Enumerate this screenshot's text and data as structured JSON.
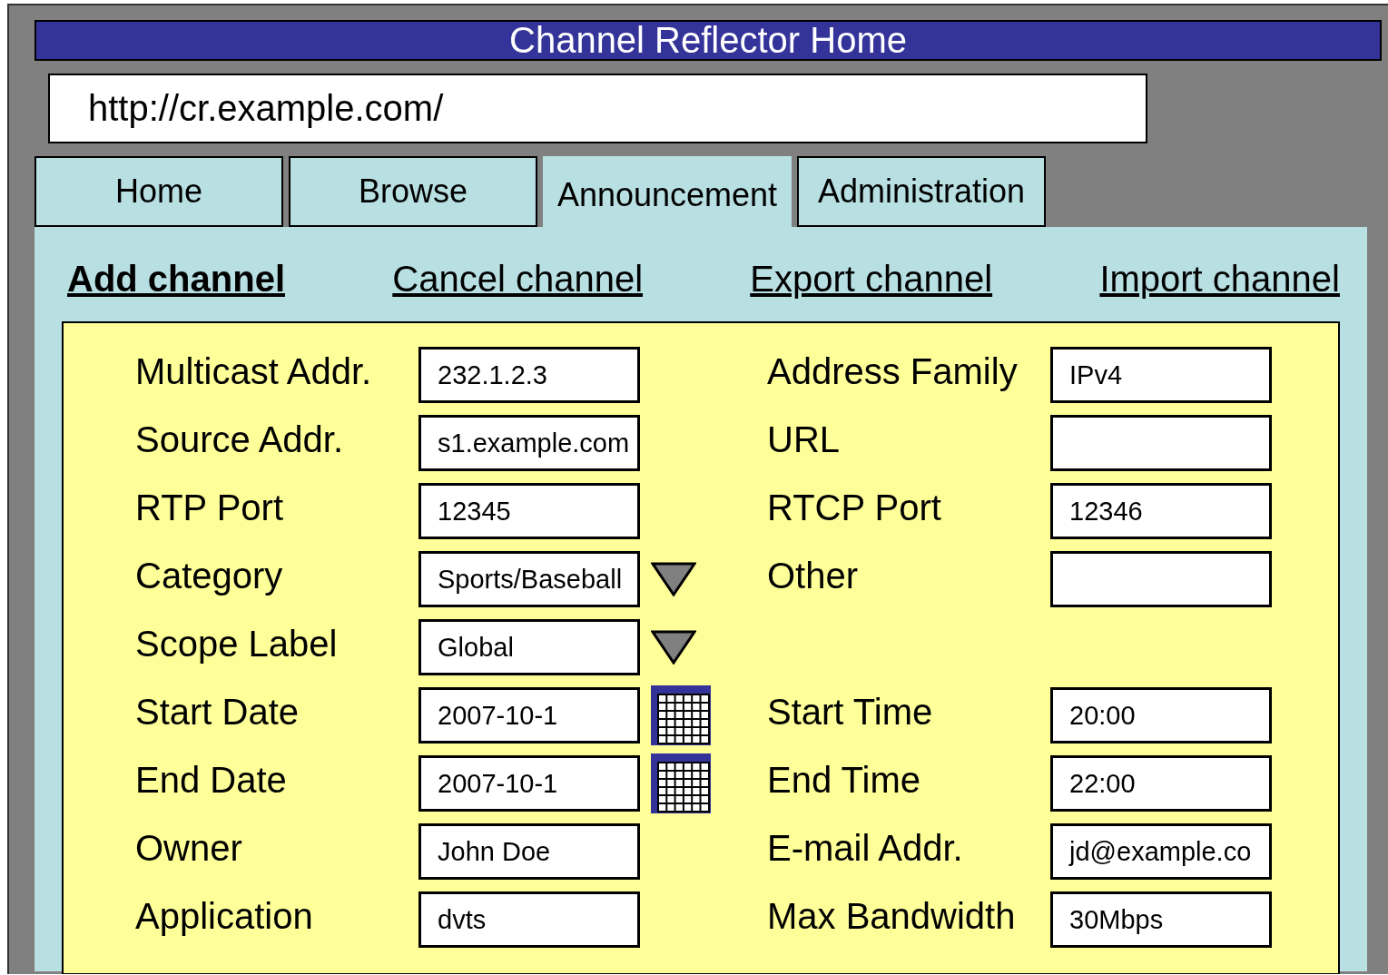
{
  "window": {
    "title": "Channel Reflector Home"
  },
  "address_bar": {
    "value": "http://cr.example.com/"
  },
  "tabs": [
    {
      "label": "Home",
      "selected": false
    },
    {
      "label": "Browse",
      "selected": false
    },
    {
      "label": "Announcement",
      "selected": true
    },
    {
      "label": "Administration",
      "selected": false
    }
  ],
  "actions": [
    {
      "label": "Add channel",
      "selected": true
    },
    {
      "label": "Cancel channel",
      "selected": false
    },
    {
      "label": "Export channel",
      "selected": false
    },
    {
      "label": "Import channel",
      "selected": false
    }
  ],
  "form": {
    "rows": [
      {
        "left": {
          "label": "Multicast Addr.",
          "value": "232.1.2.3",
          "kind": "text"
        },
        "right": {
          "label": "Address Family",
          "value": "IPv4"
        }
      },
      {
        "left": {
          "label": "Source Addr.",
          "value": "s1.example.com",
          "kind": "text"
        },
        "right": {
          "label": "URL"
        }
      },
      {
        "left": {
          "label": "RTP Port",
          "value": "12345",
          "kind": "text"
        },
        "right": {
          "label": "RTCP Port",
          "value": "12346"
        }
      },
      {
        "left": {
          "label": "Category",
          "value": "Sports/Baseball",
          "kind": "dropdown"
        },
        "right": {
          "label": "Other"
        }
      },
      {
        "left": {
          "label": "Scope Label",
          "value": "Global",
          "kind": "dropdown"
        }
      },
      {
        "left": {
          "label": "Start Date",
          "value": "2007-10-1",
          "kind": "date"
        },
        "right": {
          "label": "Start Time",
          "value": "20:00"
        }
      },
      {
        "left": {
          "label": "End Date",
          "value": "2007-10-1",
          "kind": "date"
        },
        "right": {
          "label": "End Time",
          "value": "22:00"
        }
      },
      {
        "left": {
          "label": "Owner",
          "value": "John Doe",
          "kind": "text"
        },
        "right": {
          "label": "E-mail Addr.",
          "value": "jd@example.co"
        }
      },
      {
        "left": {
          "label": "Application",
          "value": "dvts",
          "kind": "text"
        },
        "right": {
          "label": "Max Bandwidth",
          "value": "30Mbps"
        }
      }
    ]
  }
}
